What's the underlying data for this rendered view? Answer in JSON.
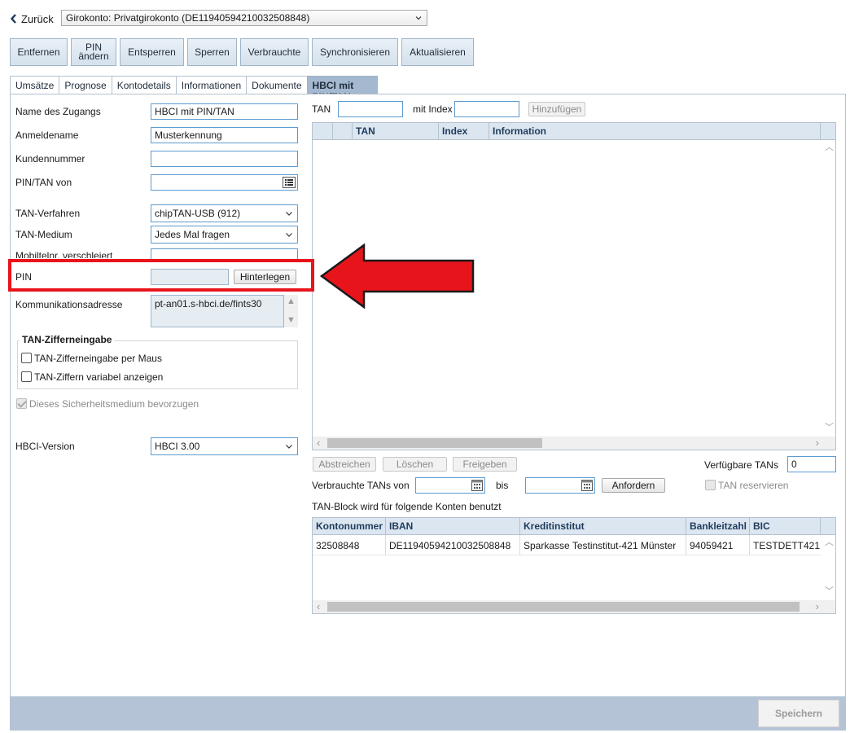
{
  "header": {
    "back_label": "Zurück",
    "account": "Girokonto: Privatgirokonto (DE11940594210032508848)"
  },
  "toolbar": {
    "buttons": [
      {
        "label": "Entfernen"
      },
      {
        "label": "PIN ändern"
      },
      {
        "label": "Entsperren"
      },
      {
        "label": "Sperren"
      },
      {
        "label": "Verbrauchte"
      },
      {
        "label": "Synchronisieren"
      },
      {
        "label": "Aktualisieren"
      }
    ],
    "pin_line1": "PIN",
    "pin_line2": "ändern"
  },
  "tabs": [
    {
      "label": "Umsätze"
    },
    {
      "label": "Prognose"
    },
    {
      "label": "Kontodetails"
    },
    {
      "label": "Informationen"
    },
    {
      "label": "Dokumente"
    },
    {
      "label": "HBCI mit PIN/TAN",
      "active": true
    }
  ],
  "form": {
    "name_label": "Name des Zugangs",
    "name_value": "HBCI mit PIN/TAN",
    "login_label": "Anmeldename",
    "login_value": "Musterkennung",
    "customer_label": "Kundennummer",
    "customer_value": "",
    "pintan_label": "PIN/TAN von",
    "pintan_value": "",
    "tan_method_label": "TAN-Verfahren",
    "tan_method_value": "chipTAN-USB (912)",
    "tan_medium_label": "TAN-Medium",
    "tan_medium_value": "Jedes Mal fragen",
    "mobile_label": "Mobiltelnr. verschleiert",
    "pin_label": "PIN",
    "pin_button": "Hinterlegen",
    "comm_label": "Kommunikationsadresse",
    "comm_value": "pt-an01.s-hbci.de/fints30",
    "tan_digits_legend": "TAN-Zifferneingabe",
    "tan_digits_mouse": "TAN-Zifferneingabe per Maus",
    "tan_digits_variable": "TAN-Ziffern variabel anzeigen",
    "prefer_medium": "Dieses Sicherheitsmedium bevorzugen",
    "hbci_version_label": "HBCI-Version",
    "hbci_version_value": "HBCI 3.00"
  },
  "tan_panel": {
    "tan_label": "TAN",
    "index_label": "mit Index",
    "add_button": "Hinzufügen",
    "columns": [
      "TAN",
      "Index",
      "Information"
    ],
    "strike_button": "Abstreichen",
    "delete_button": "Löschen",
    "release_button": "Freigeben",
    "available_label": "Verfügbare TANs",
    "available_value": "0",
    "used_from_label": "Verbrauchte TANs von",
    "to_label": "bis",
    "request_button": "Anfordern",
    "reserve_label": "TAN reservieren",
    "block_label": "TAN-Block wird für folgende Konten benutzt"
  },
  "accounts_table": {
    "columns": [
      "Kontonummer",
      "IBAN",
      "Kreditinstitut",
      "Bankleitzahl",
      "BIC"
    ],
    "rows": [
      [
        "32508848",
        "DE11940594210032508848",
        "Sparkasse Testinstitut-421 Münster",
        "94059421",
        "TESTDETT421"
      ]
    ]
  },
  "footer": {
    "save_button": "Speichern"
  },
  "colors": {
    "accent": "#a4b8cf",
    "annotation": "#e8141c",
    "header_blue": "#1e3b5c"
  }
}
